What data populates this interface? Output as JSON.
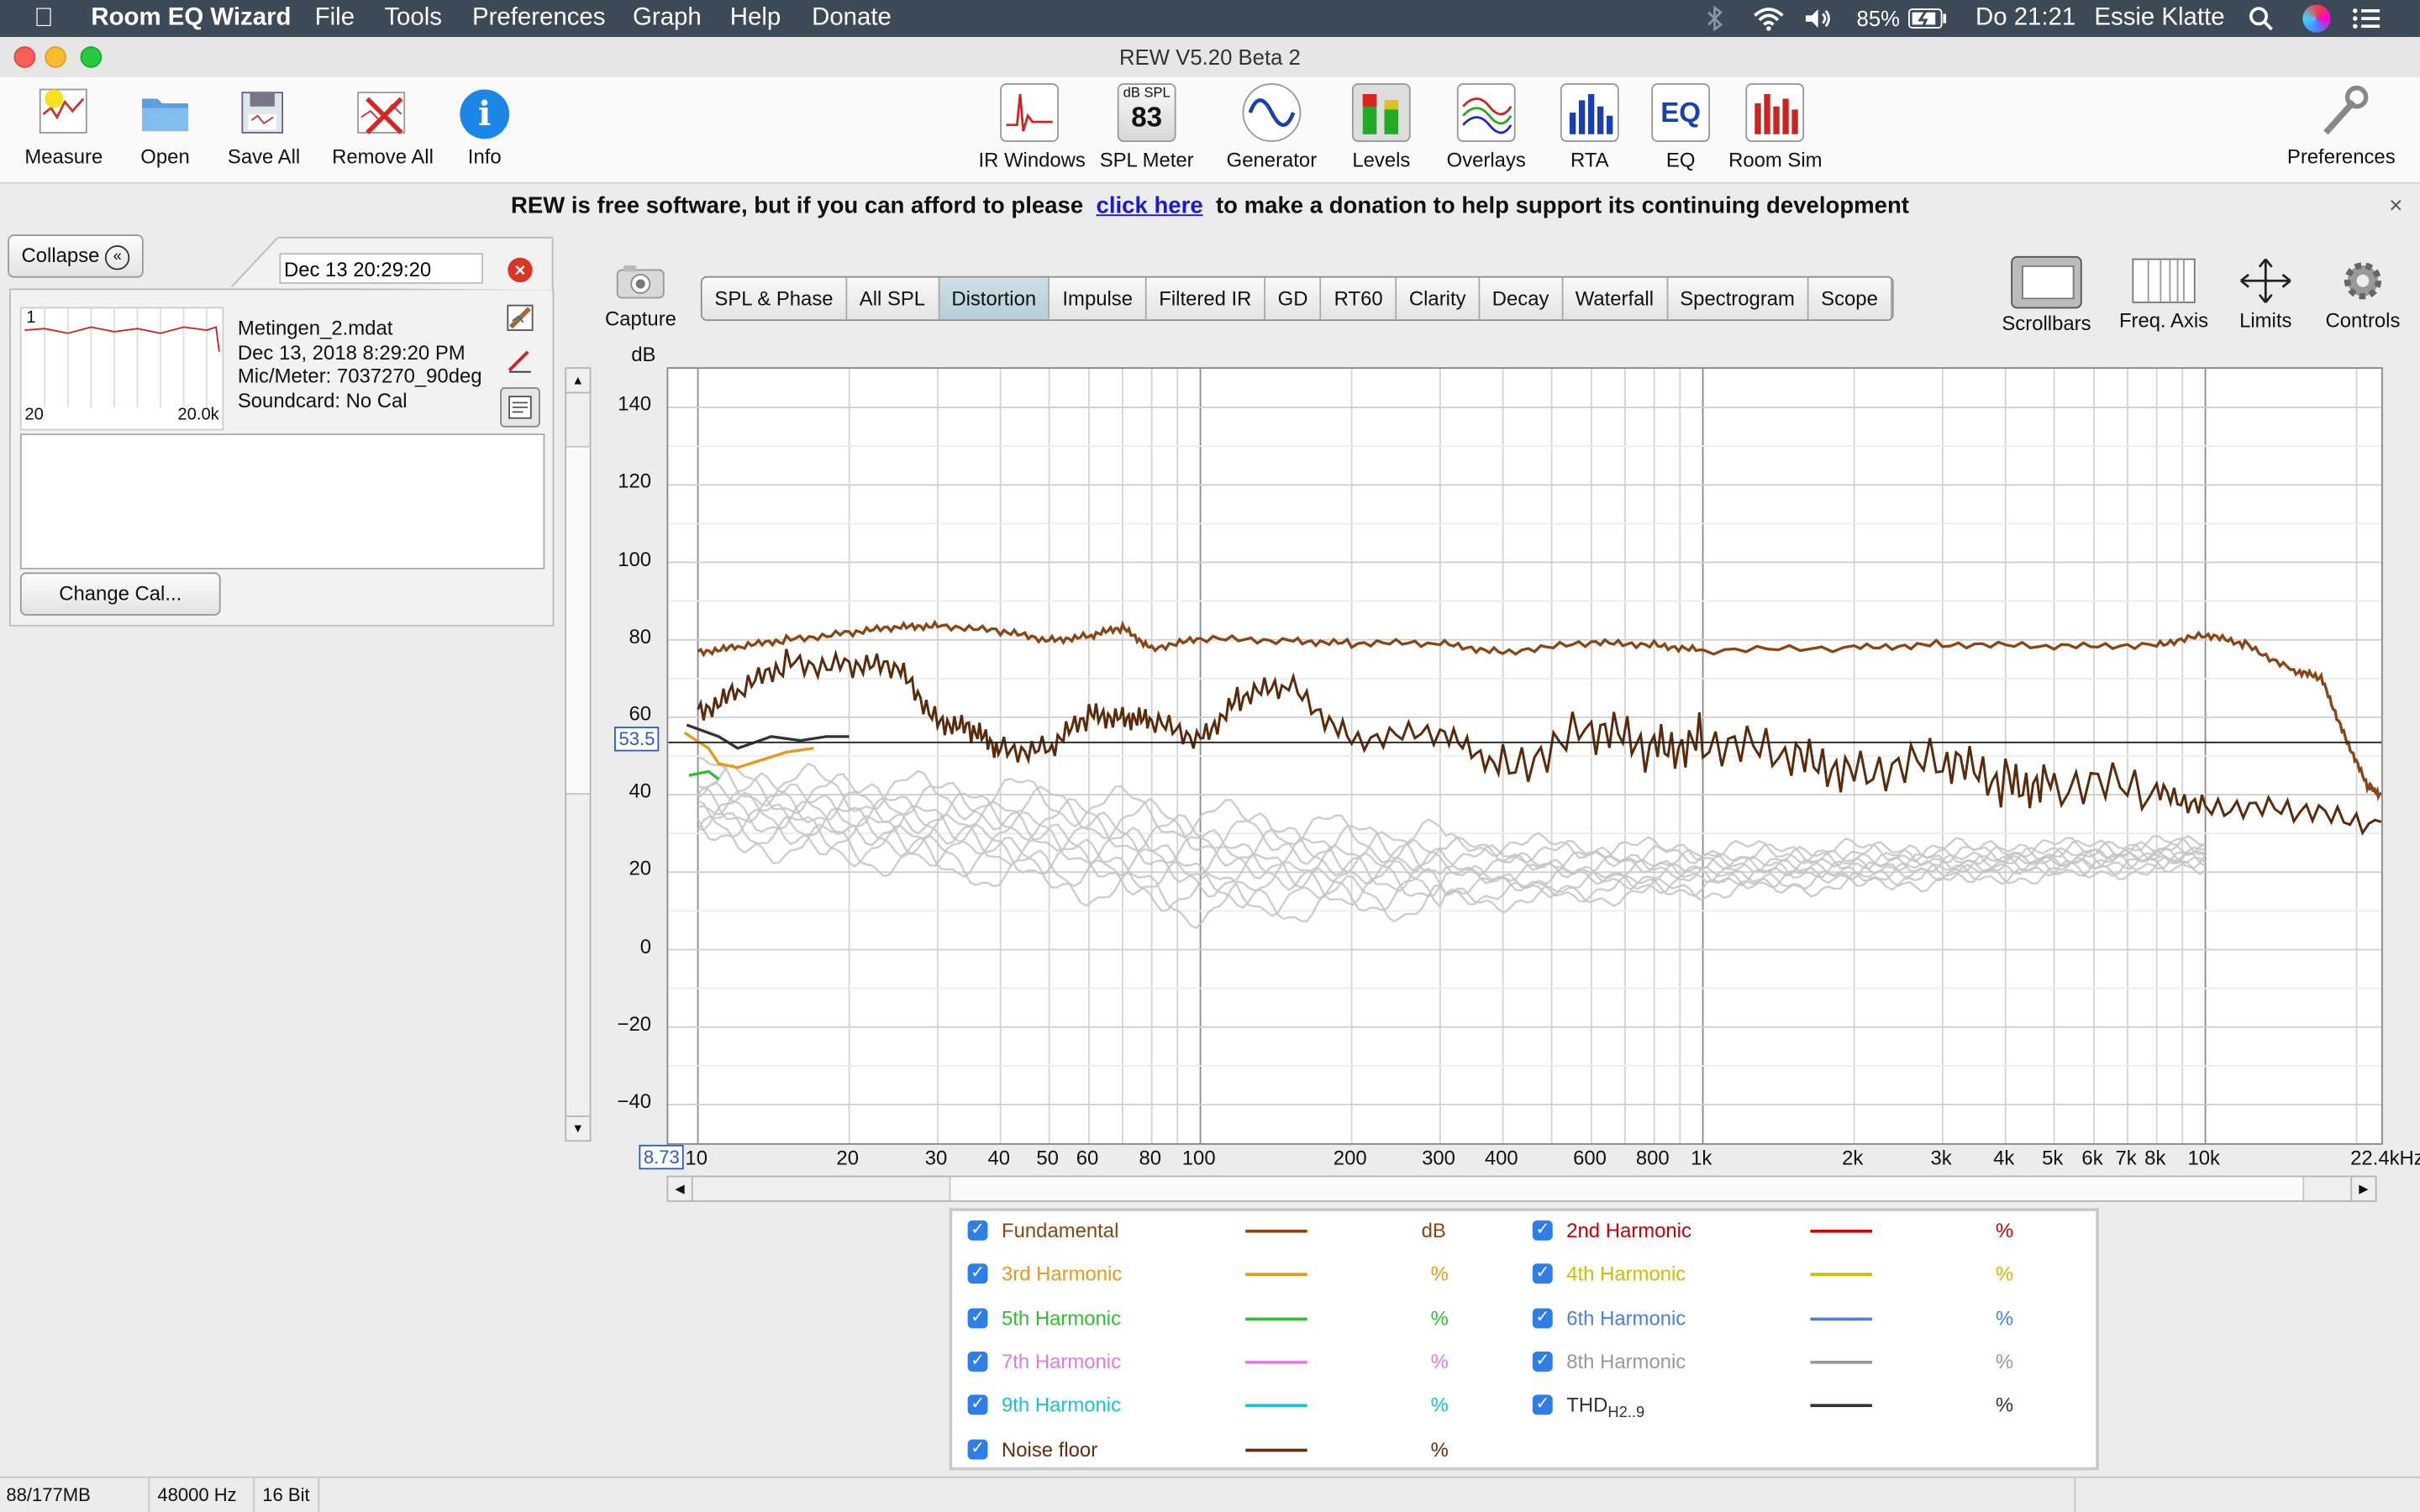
{
  "menubar": {
    "apple_icon": "apple-icon",
    "app": "Room EQ Wizard",
    "items": [
      "File",
      "Tools",
      "Preferences",
      "Graph",
      "Help",
      "Donate"
    ],
    "battery": "85%",
    "clock": "Do 21:21",
    "user": "Essie Klatte"
  },
  "window": {
    "title": "REW V5.20 Beta 2"
  },
  "toolbar": {
    "measure": "Measure",
    "open": "Open",
    "save_all": "Save All",
    "remove_all": "Remove All",
    "info": "Info",
    "ir_windows": "IR Windows",
    "spl_meter": "SPL Meter",
    "spl_meter_icon_top": "dB SPL",
    "spl_meter_icon_value": "83",
    "generator": "Generator",
    "levels": "Levels",
    "overlays": "Overlays",
    "rta": "RTA",
    "eq": "EQ",
    "eq_icon_text": "EQ",
    "room_sim": "Room Sim",
    "preferences": "Preferences"
  },
  "banner": {
    "before": "REW is free software, but if you can afford to please",
    "link": "click here",
    "after": "to make a donation to help support its continuing development",
    "close": "×"
  },
  "left": {
    "collapse": "Collapse",
    "date_field": "Dec 13 20:29:20",
    "thumb_index": "1",
    "thumb_min": "20",
    "thumb_max": "20.0k",
    "meas_name": "Metingen_2.mdat",
    "meas_date": "Dec 13, 2018 8:29:20 PM",
    "meas_mic": "Mic/Meter: 7037270_90deg",
    "meas_soundcard": "Soundcard: No Cal",
    "change_cal": "Change Cal..."
  },
  "graph": {
    "capture": "Capture",
    "tabs": [
      "SPL & Phase",
      "All SPL",
      "Distortion",
      "Impulse",
      "Filtered IR",
      "GD",
      "RT60",
      "Clarity",
      "Decay",
      "Waterfall",
      "Spectrogram",
      "Scope"
    ],
    "active_tab": 2,
    "tools": {
      "scrollbars": "Scrollbars",
      "freq_axis": "Freq. Axis",
      "limits": "Limits",
      "controls": "Controls"
    },
    "y_unit": "dB",
    "cursor_y": "53.5",
    "cursor_x": "8.73"
  },
  "chart_data": {
    "type": "line",
    "xscale": "log",
    "xlim_hz": [
      8.73,
      22400
    ],
    "ylim": [
      -50,
      150
    ],
    "yticks": [
      140,
      120,
      100,
      80,
      60,
      40,
      20,
      0,
      -20,
      -40
    ],
    "ytick_labels": [
      "140",
      "120",
      "100",
      "80",
      "60",
      "40",
      "20",
      "0",
      "−20",
      "−40"
    ],
    "xticks": [
      10,
      20,
      30,
      40,
      50,
      60,
      80,
      100,
      200,
      300,
      400,
      600,
      800,
      1000,
      2000,
      3000,
      4000,
      5000,
      6000,
      7000,
      8000,
      10000,
      22400
    ],
    "xtick_labels": [
      "10",
      "20",
      "30",
      "40",
      "50",
      "60",
      "80",
      "100",
      "200",
      "300",
      "400",
      "600",
      "800",
      "1k",
      "2k",
      "3k",
      "4k",
      "5k",
      "6k",
      "7k",
      "8k",
      "10k",
      "22.4kHz"
    ],
    "cursor_level_db": 53.5,
    "series": [
      {
        "name": "Fundamental",
        "color": "#8b4513",
        "points": [
          [
            10,
            77
          ],
          [
            12,
            78
          ],
          [
            15,
            80
          ],
          [
            20,
            82
          ],
          [
            25,
            83
          ],
          [
            30,
            84
          ],
          [
            40,
            82
          ],
          [
            50,
            80
          ],
          [
            60,
            81
          ],
          [
            70,
            83
          ],
          [
            80,
            78
          ],
          [
            100,
            80
          ],
          [
            150,
            80
          ],
          [
            200,
            79
          ],
          [
            300,
            79
          ],
          [
            400,
            77
          ],
          [
            600,
            79
          ],
          [
            800,
            79
          ],
          [
            1000,
            77
          ],
          [
            2000,
            78
          ],
          [
            3000,
            79
          ],
          [
            5000,
            78
          ],
          [
            8000,
            79
          ],
          [
            10000,
            81
          ],
          [
            12000,
            79
          ],
          [
            15000,
            72
          ],
          [
            17000,
            70
          ],
          [
            19000,
            55
          ],
          [
            21000,
            42
          ],
          [
            22400,
            40
          ]
        ]
      },
      {
        "name": "Noise floor",
        "color": "#5a2a0a",
        "points": [
          [
            10,
            62
          ],
          [
            12,
            66
          ],
          [
            15,
            74
          ],
          [
            20,
            74
          ],
          [
            25,
            72
          ],
          [
            30,
            60
          ],
          [
            35,
            56
          ],
          [
            40,
            52
          ],
          [
            50,
            52
          ],
          [
            60,
            60
          ],
          [
            70,
            61
          ],
          [
            80,
            58
          ],
          [
            100,
            55
          ],
          [
            120,
            65
          ],
          [
            150,
            68
          ],
          [
            200,
            55
          ],
          [
            300,
            55
          ],
          [
            400,
            48
          ],
          [
            600,
            56
          ],
          [
            800,
            52
          ],
          [
            1000,
            55
          ],
          [
            1500,
            48
          ],
          [
            2000,
            48
          ],
          [
            3000,
            47
          ],
          [
            4000,
            44
          ],
          [
            5000,
            43
          ],
          [
            8000,
            40
          ],
          [
            10000,
            38
          ],
          [
            15000,
            35
          ],
          [
            22400,
            33
          ]
        ]
      },
      {
        "name": "3rd Harmonic",
        "color": "#e69a1a",
        "points": [
          [
            9.4,
            56
          ],
          [
            10.5,
            52
          ],
          [
            11,
            48
          ],
          [
            12,
            47
          ],
          [
            15,
            51
          ],
          [
            17,
            52
          ]
        ]
      },
      {
        "name": "5th Harmonic",
        "color": "#2fc02f",
        "points": [
          [
            9.6,
            45
          ],
          [
            10.5,
            46
          ],
          [
            11,
            44
          ]
        ]
      },
      {
        "name": "THD",
        "color": "#333333",
        "points": [
          [
            9.5,
            58
          ],
          [
            11,
            55
          ],
          [
            12,
            52
          ],
          [
            14,
            55
          ],
          [
            16,
            54
          ],
          [
            18,
            55
          ],
          [
            20,
            55
          ]
        ]
      }
    ],
    "gray_band": {
      "color": "#c4c4c4",
      "upper": [
        [
          10,
          45
        ],
        [
          20,
          42
        ],
        [
          50,
          40
        ],
        [
          100,
          35
        ],
        [
          200,
          30
        ],
        [
          400,
          28
        ],
        [
          1000,
          26
        ],
        [
          3000,
          26
        ],
        [
          10000,
          27
        ]
      ],
      "lower": [
        [
          10,
          30
        ],
        [
          20,
          25
        ],
        [
          50,
          18
        ],
        [
          100,
          10
        ],
        [
          200,
          12
        ],
        [
          400,
          12
        ],
        [
          1000,
          15
        ],
        [
          3000,
          18
        ],
        [
          10000,
          22
        ]
      ]
    }
  },
  "legend": [
    {
      "name": "Fundamental",
      "color": "#8b4513",
      "unit": "dB"
    },
    {
      "name": "2nd Harmonic",
      "color": "#cc0000",
      "unit": "%"
    },
    {
      "name": "3rd Harmonic",
      "color": "#e69a1a",
      "unit": "%"
    },
    {
      "name": "4th Harmonic",
      "color": "#c8c000",
      "unit": "%"
    },
    {
      "name": "5th Harmonic",
      "color": "#2fc02f",
      "unit": "%"
    },
    {
      "name": "6th Harmonic",
      "color": "#4a7ee6",
      "unit": "%"
    },
    {
      "name": "7th Harmonic",
      "color": "#e07ee0",
      "unit": "%"
    },
    {
      "name": "8th Harmonic",
      "color": "#999999",
      "unit": "%"
    },
    {
      "name": "9th Harmonic",
      "color": "#19c3d6",
      "unit": "%"
    },
    {
      "name": "THD",
      "sub": "H2..9",
      "color": "#333333",
      "unit": "%"
    },
    {
      "name": "Noise floor",
      "color": "#6a2a0c",
      "unit": "%"
    }
  ],
  "status": {
    "memory": "88/177MB",
    "rate": "48000 Hz",
    "bits": "16 Bit"
  }
}
